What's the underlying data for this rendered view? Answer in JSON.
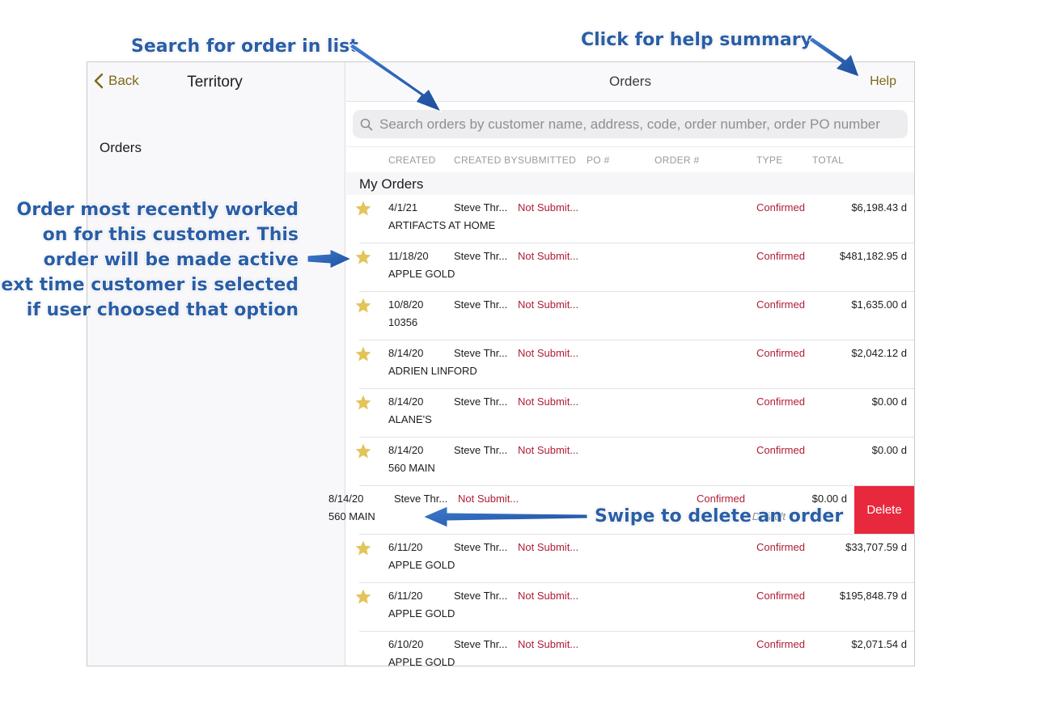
{
  "sidebar": {
    "back_label": "Back",
    "title": "Territory",
    "item_orders": "Orders"
  },
  "header": {
    "title": "Orders",
    "help_label": "Help"
  },
  "search": {
    "placeholder": "Search orders by customer name, address, code, order number, order PO number"
  },
  "columns": [
    "CREATED",
    "CREATED BY",
    "SUBMITTED",
    "PO #",
    "ORDER #",
    "TYPE",
    "TOTAL"
  ],
  "section_title": "My Orders",
  "orders": [
    {
      "starred": true,
      "created": "4/1/21",
      "created_by": "Steve Thr...",
      "submitted": "Not Submit...",
      "type": "Confirmed",
      "total": "$6,198.43 d",
      "customer": "ARTIFACTS AT HOME"
    },
    {
      "starred": true,
      "created": "11/18/20",
      "created_by": "Steve Thr...",
      "submitted": "Not Submit...",
      "type": "Confirmed",
      "total": "$481,182.95 d",
      "customer": "APPLE GOLD"
    },
    {
      "starred": true,
      "created": "10/8/20",
      "created_by": "Steve Thr...",
      "submitted": "Not Submit...",
      "type": "Confirmed",
      "total": "$1,635.00 d",
      "customer": "10356"
    },
    {
      "starred": true,
      "created": "8/14/20",
      "created_by": "Steve Thr...",
      "submitted": "Not Submit...",
      "type": "Confirmed",
      "total": "$2,042.12 d",
      "customer": "ADRIEN LINFORD"
    },
    {
      "starred": true,
      "created": "8/14/20",
      "created_by": "Steve Thr...",
      "submitted": "Not Submit...",
      "type": "Confirmed",
      "total": "$0.00 d",
      "customer": "ALANE'S"
    },
    {
      "starred": true,
      "created": "8/14/20",
      "created_by": "Steve Thr...",
      "submitted": "Not Submit...",
      "type": "Confirmed",
      "total": "$0.00 d",
      "customer": "560 MAIN"
    },
    {
      "starred": false,
      "swiped": true,
      "created": "8/14/20",
      "created_by": "Steve Thr...",
      "submitted": "Not Submit...",
      "type": "Confirmed",
      "total": "$0.00 d",
      "customer": "560 MAIN",
      "note": "Default",
      "delete_label": "Delete"
    },
    {
      "starred": true,
      "created": "6/11/20",
      "created_by": "Steve Thr...",
      "submitted": "Not Submit...",
      "type": "Confirmed",
      "total": "$33,707.59 d",
      "customer": "APPLE GOLD"
    },
    {
      "starred": true,
      "created": "6/11/20",
      "created_by": "Steve Thr...",
      "submitted": "Not Submit...",
      "type": "Confirmed",
      "total": "$195,848.79 d",
      "customer": "APPLE GOLD"
    },
    {
      "starred": false,
      "created": "6/10/20",
      "created_by": "Steve Thr...",
      "submitted": "Not Submit...",
      "type": "Confirmed",
      "total": "$2,071.54 d",
      "customer": "APPLE GOLD"
    }
  ],
  "annotations": {
    "search": "Search for order in list",
    "help": "Click for help summary",
    "recent": [
      "Order most recently worked",
      "on for this customer.  This",
      "order will be made active",
      "next time customer is selected",
      "if user choosed that option"
    ],
    "swipe": "Swipe to delete an order"
  },
  "colors": {
    "accent": "#7d6a17",
    "status": "#b01c36",
    "star": "#e3c45a",
    "delete": "#e8293d",
    "annotation": "#2a5ea6"
  }
}
